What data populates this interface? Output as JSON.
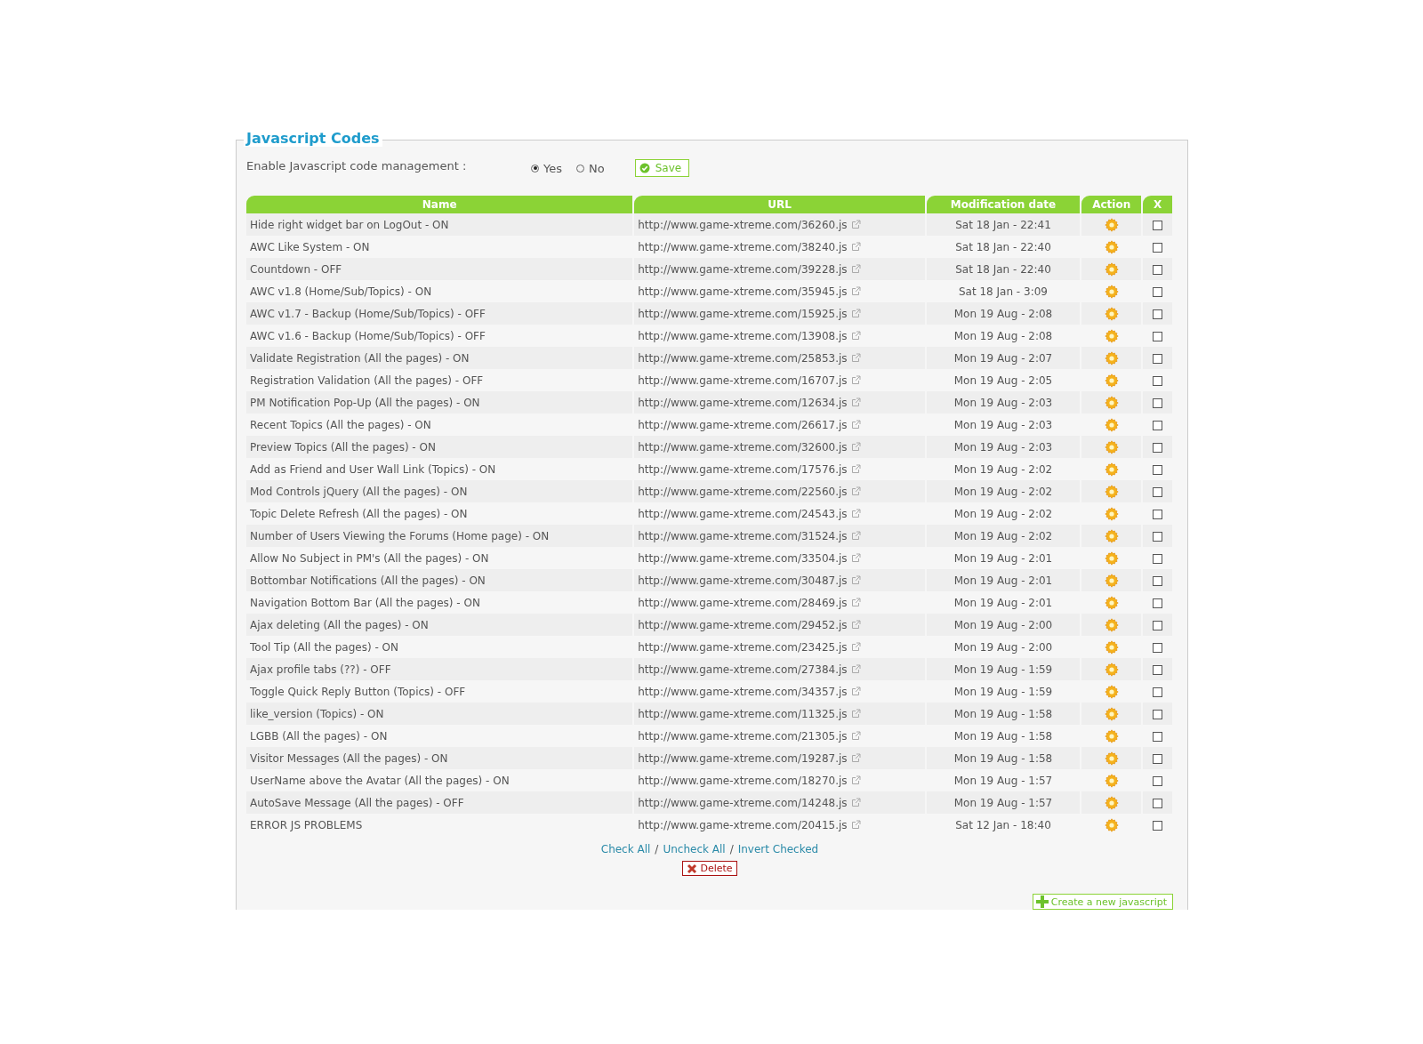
{
  "panel": {
    "title": "Javascript Codes"
  },
  "setting": {
    "label": "Enable Javascript code management :",
    "options": [
      {
        "label": "Yes",
        "selected": true
      },
      {
        "label": "No",
        "selected": false
      }
    ],
    "save": "Save"
  },
  "table": {
    "columns": [
      "Name",
      "URL",
      "Modification date",
      "Action",
      "X"
    ],
    "rows": [
      {
        "name": "Hide right widget bar on LogOut - ON",
        "url": "http://www.game-xtreme.com/36260.js",
        "date": "Sat 18 Jan - 22:41",
        "checked": false
      },
      {
        "name": "AWC Like System - ON",
        "url": "http://www.game-xtreme.com/38240.js",
        "date": "Sat 18 Jan - 22:40",
        "checked": false
      },
      {
        "name": "Countdown - OFF",
        "url": "http://www.game-xtreme.com/39228.js",
        "date": "Sat 18 Jan - 22:40",
        "checked": false
      },
      {
        "name": "AWC v1.8 (Home/Sub/Topics) - ON",
        "url": "http://www.game-xtreme.com/35945.js",
        "date": "Sat 18 Jan - 3:09",
        "checked": false
      },
      {
        "name": "AWC v1.7 - Backup (Home/Sub/Topics) - OFF",
        "url": "http://www.game-xtreme.com/15925.js",
        "date": "Mon 19 Aug - 2:08",
        "checked": false
      },
      {
        "name": "AWC v1.6 - Backup (Home/Sub/Topics) - OFF",
        "url": "http://www.game-xtreme.com/13908.js",
        "date": "Mon 19 Aug - 2:08",
        "checked": false
      },
      {
        "name": "Validate Registration (All the pages) - ON",
        "url": "http://www.game-xtreme.com/25853.js",
        "date": "Mon 19 Aug - 2:07",
        "checked": false
      },
      {
        "name": "Registration Validation (All the pages) - OFF",
        "url": "http://www.game-xtreme.com/16707.js",
        "date": "Mon 19 Aug - 2:05",
        "checked": false
      },
      {
        "name": "PM Notification Pop-Up (All the pages) - ON",
        "url": "http://www.game-xtreme.com/12634.js",
        "date": "Mon 19 Aug - 2:03",
        "checked": false
      },
      {
        "name": "Recent Topics (All the pages) - ON",
        "url": "http://www.game-xtreme.com/26617.js",
        "date": "Mon 19 Aug - 2:03",
        "checked": false
      },
      {
        "name": "Preview Topics (All the pages) - ON",
        "url": "http://www.game-xtreme.com/32600.js",
        "date": "Mon 19 Aug - 2:03",
        "checked": false
      },
      {
        "name": "Add as Friend and User Wall Link (Topics) - ON",
        "url": "http://www.game-xtreme.com/17576.js",
        "date": "Mon 19 Aug - 2:02",
        "checked": false
      },
      {
        "name": "Mod Controls jQuery (All the pages) - ON",
        "url": "http://www.game-xtreme.com/22560.js",
        "date": "Mon 19 Aug - 2:02",
        "checked": false
      },
      {
        "name": "Topic Delete Refresh (All the pages) - ON",
        "url": "http://www.game-xtreme.com/24543.js",
        "date": "Mon 19 Aug - 2:02",
        "checked": false
      },
      {
        "name": "Number of Users Viewing the Forums (Home page) - ON",
        "url": "http://www.game-xtreme.com/31524.js",
        "date": "Mon 19 Aug - 2:02",
        "checked": false
      },
      {
        "name": "Allow No Subject in PM's (All the pages) - ON",
        "url": "http://www.game-xtreme.com/33504.js",
        "date": "Mon 19 Aug - 2:01",
        "checked": false
      },
      {
        "name": "Bottombar Notifications (All the pages) - ON",
        "url": "http://www.game-xtreme.com/30487.js",
        "date": "Mon 19 Aug - 2:01",
        "checked": false
      },
      {
        "name": "Navigation Bottom Bar (All the pages) - ON",
        "url": "http://www.game-xtreme.com/28469.js",
        "date": "Mon 19 Aug - 2:01",
        "checked": false
      },
      {
        "name": "Ajax deleting (All the pages) - ON",
        "url": "http://www.game-xtreme.com/29452.js",
        "date": "Mon 19 Aug - 2:00",
        "checked": false
      },
      {
        "name": "Tool Tip (All the pages) - ON",
        "url": "http://www.game-xtreme.com/23425.js",
        "date": "Mon 19 Aug - 2:00",
        "checked": false
      },
      {
        "name": "Ajax profile tabs (??) - OFF",
        "url": "http://www.game-xtreme.com/27384.js",
        "date": "Mon 19 Aug - 1:59",
        "checked": false
      },
      {
        "name": "Toggle Quick Reply Button (Topics) - OFF",
        "url": "http://www.game-xtreme.com/34357.js",
        "date": "Mon 19 Aug - 1:59",
        "checked": false
      },
      {
        "name": "like_version (Topics) - ON",
        "url": "http://www.game-xtreme.com/11325.js",
        "date": "Mon 19 Aug - 1:58",
        "checked": false
      },
      {
        "name": "LGBB (All the pages) - ON",
        "url": "http://www.game-xtreme.com/21305.js",
        "date": "Mon 19 Aug - 1:58",
        "checked": false
      },
      {
        "name": "Visitor Messages (All the pages) - ON",
        "url": "http://www.game-xtreme.com/19287.js",
        "date": "Mon 19 Aug - 1:58",
        "checked": false
      },
      {
        "name": "UserName above the Avatar (All the pages) - ON",
        "url": "http://www.game-xtreme.com/18270.js",
        "date": "Mon 19 Aug - 1:57",
        "checked": false
      },
      {
        "name": "AutoSave Message (All the pages) - OFF",
        "url": "http://www.game-xtreme.com/14248.js",
        "date": "Mon 19 Aug - 1:57",
        "checked": false
      },
      {
        "name": "ERROR JS PROBLEMS",
        "url": "http://www.game-xtreme.com/20415.js",
        "date": "Sat 12 Jan - 18:40",
        "checked": false
      }
    ]
  },
  "selection_links": [
    {
      "label": "Check All",
      "separator": "/"
    },
    {
      "label": "Uncheck All",
      "separator": "/"
    },
    {
      "label": "Invert Checked"
    }
  ],
  "delete_button": "Delete",
  "create_button": "Create a new javascript"
}
